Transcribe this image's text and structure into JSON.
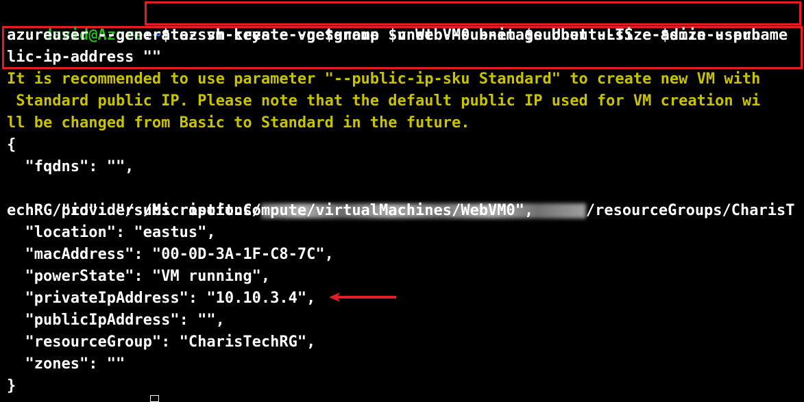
{
  "terminal": {
    "prompt": {
      "user_host": "david@Azure",
      "colon": ":",
      "path": "~",
      "symbol": "$"
    },
    "command_part1": "az vm create -g $group -n WebVM0 --image UbuntuLTS --admin-username",
    "command_part2": "azureuser --generate-ssh-keys --vnet-name $vnet --subnet $subnet --size $size --pub",
    "command_part3": "lic-ip-address \"\"",
    "warning": [
      "It is recommended to use parameter \"--public-ip-sku Standard\" to create new VM with",
      " Standard public IP. Please note that the default public IP used for VM creation wi",
      "ll be changed from Basic to Standard in the future."
    ],
    "output": {
      "open_brace": "{",
      "fqdns": "  \"fqdns\": \"\",",
      "id_prefix": "  \"id\": \"/subscriptions/",
      "id_suffix": "/resourceGroups/CharisT",
      "id_line2": "echRG/providers/Microsoft.Compute/virtualMachines/WebVM0\",",
      "location": "  \"location\": \"eastus\",",
      "mac_address": "  \"macAddress\": \"00-0D-3A-1F-C8-7C\",",
      "power_state": "  \"powerState\": \"VM running\",",
      "private_ip": "  \"privateIpAddress\": \"10.10.3.4\",",
      "public_ip": "  \"publicIpAddress\": \"\",",
      "resource_group": "  \"resourceGroup\": \"CharisTechRG\",",
      "zones": "  \"zones\": \"\"",
      "close_brace": "}"
    }
  },
  "colors": {
    "background": "#000000",
    "prompt_user": "#25bc24",
    "prompt_path": "#3b78ff",
    "warning_text": "#c9c200",
    "highlight_box": "#e51c23",
    "arrow": "#e51c23"
  }
}
